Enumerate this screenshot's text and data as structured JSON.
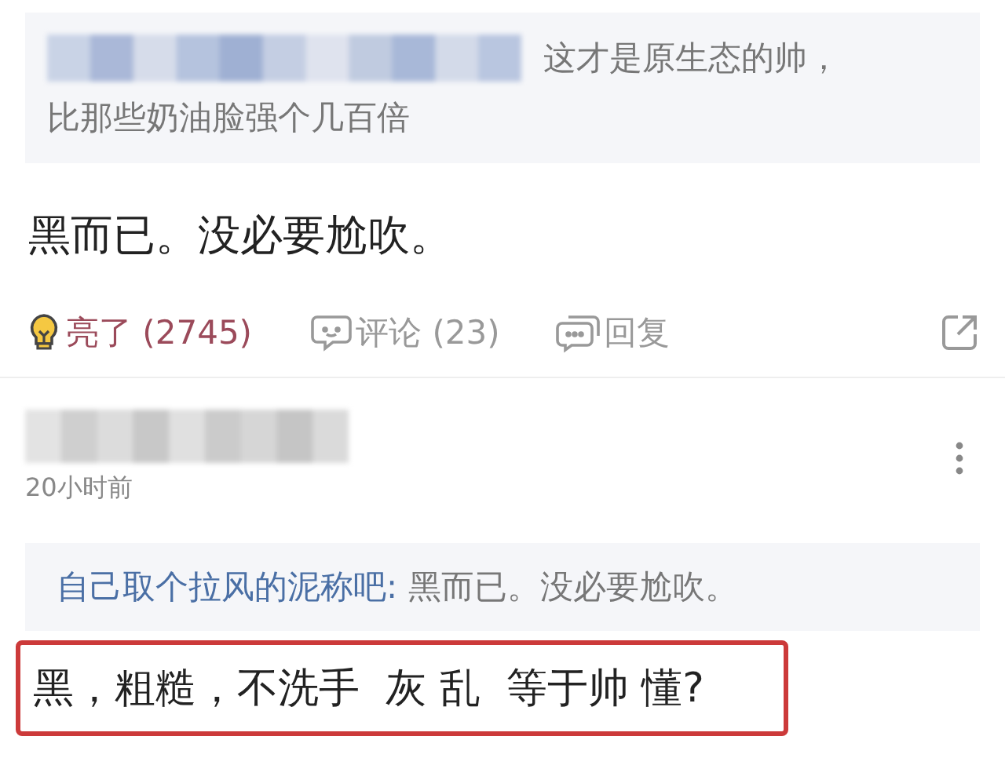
{
  "first_comment": {
    "quote": {
      "lines": [
        "这才是原生态的帅，",
        "比那些奶油脸强个几百倍"
      ]
    },
    "body": "黑而已。没必要尬吹。",
    "actions": [
      {
        "kind": "light",
        "label": "亮了 (2745)"
      },
      {
        "kind": "comment",
        "label": "评论 (23)"
      },
      {
        "kind": "reply",
        "label": "回复"
      },
      {
        "kind": "share"
      }
    ]
  },
  "second_comment": {
    "time": "20小时前",
    "quote": {
      "author": "自己取个拉风的泥称吧:",
      "text": "黑而已。没必要尬吹。"
    },
    "body": "黑，粗糙，不洗手  灰 乱  等于帅 懂?",
    "highlighted": true
  }
}
